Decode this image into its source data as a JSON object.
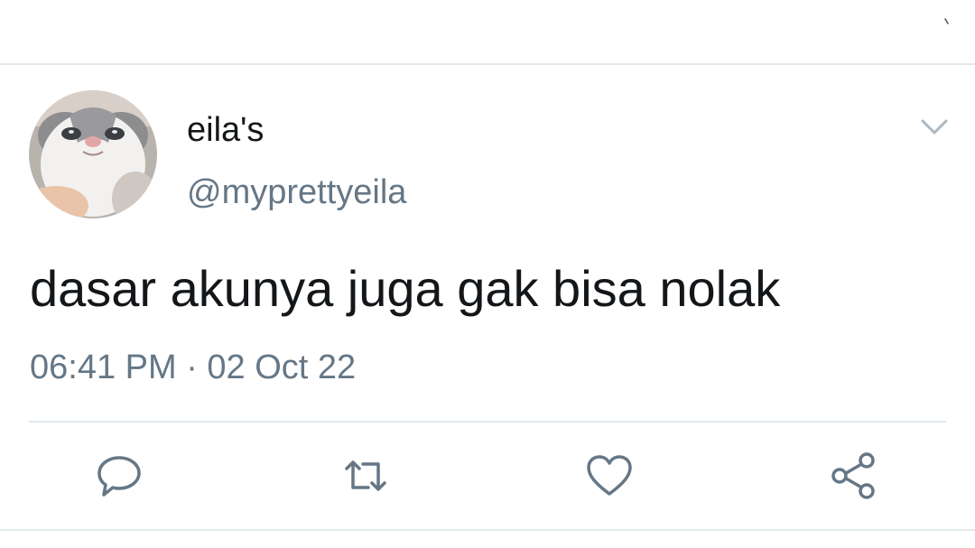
{
  "tweet": {
    "display_name": "eila's",
    "handle": "@myprettyeila",
    "text": "dasar akunya juga gak bisa nolak",
    "timestamp": "06:41 PM · 02 Oct 22"
  },
  "icons": {
    "avatar": "cat-avatar",
    "more": "chevron-down-icon",
    "reply": "reply-icon",
    "retweet": "retweet-icon",
    "like": "heart-icon",
    "share": "share-icon"
  },
  "colors": {
    "text_primary": "#14171a",
    "text_secondary": "#657786",
    "divider": "#e1e8ed",
    "icon_gray": "#657786",
    "chevron_gray": "#aab8c2"
  }
}
